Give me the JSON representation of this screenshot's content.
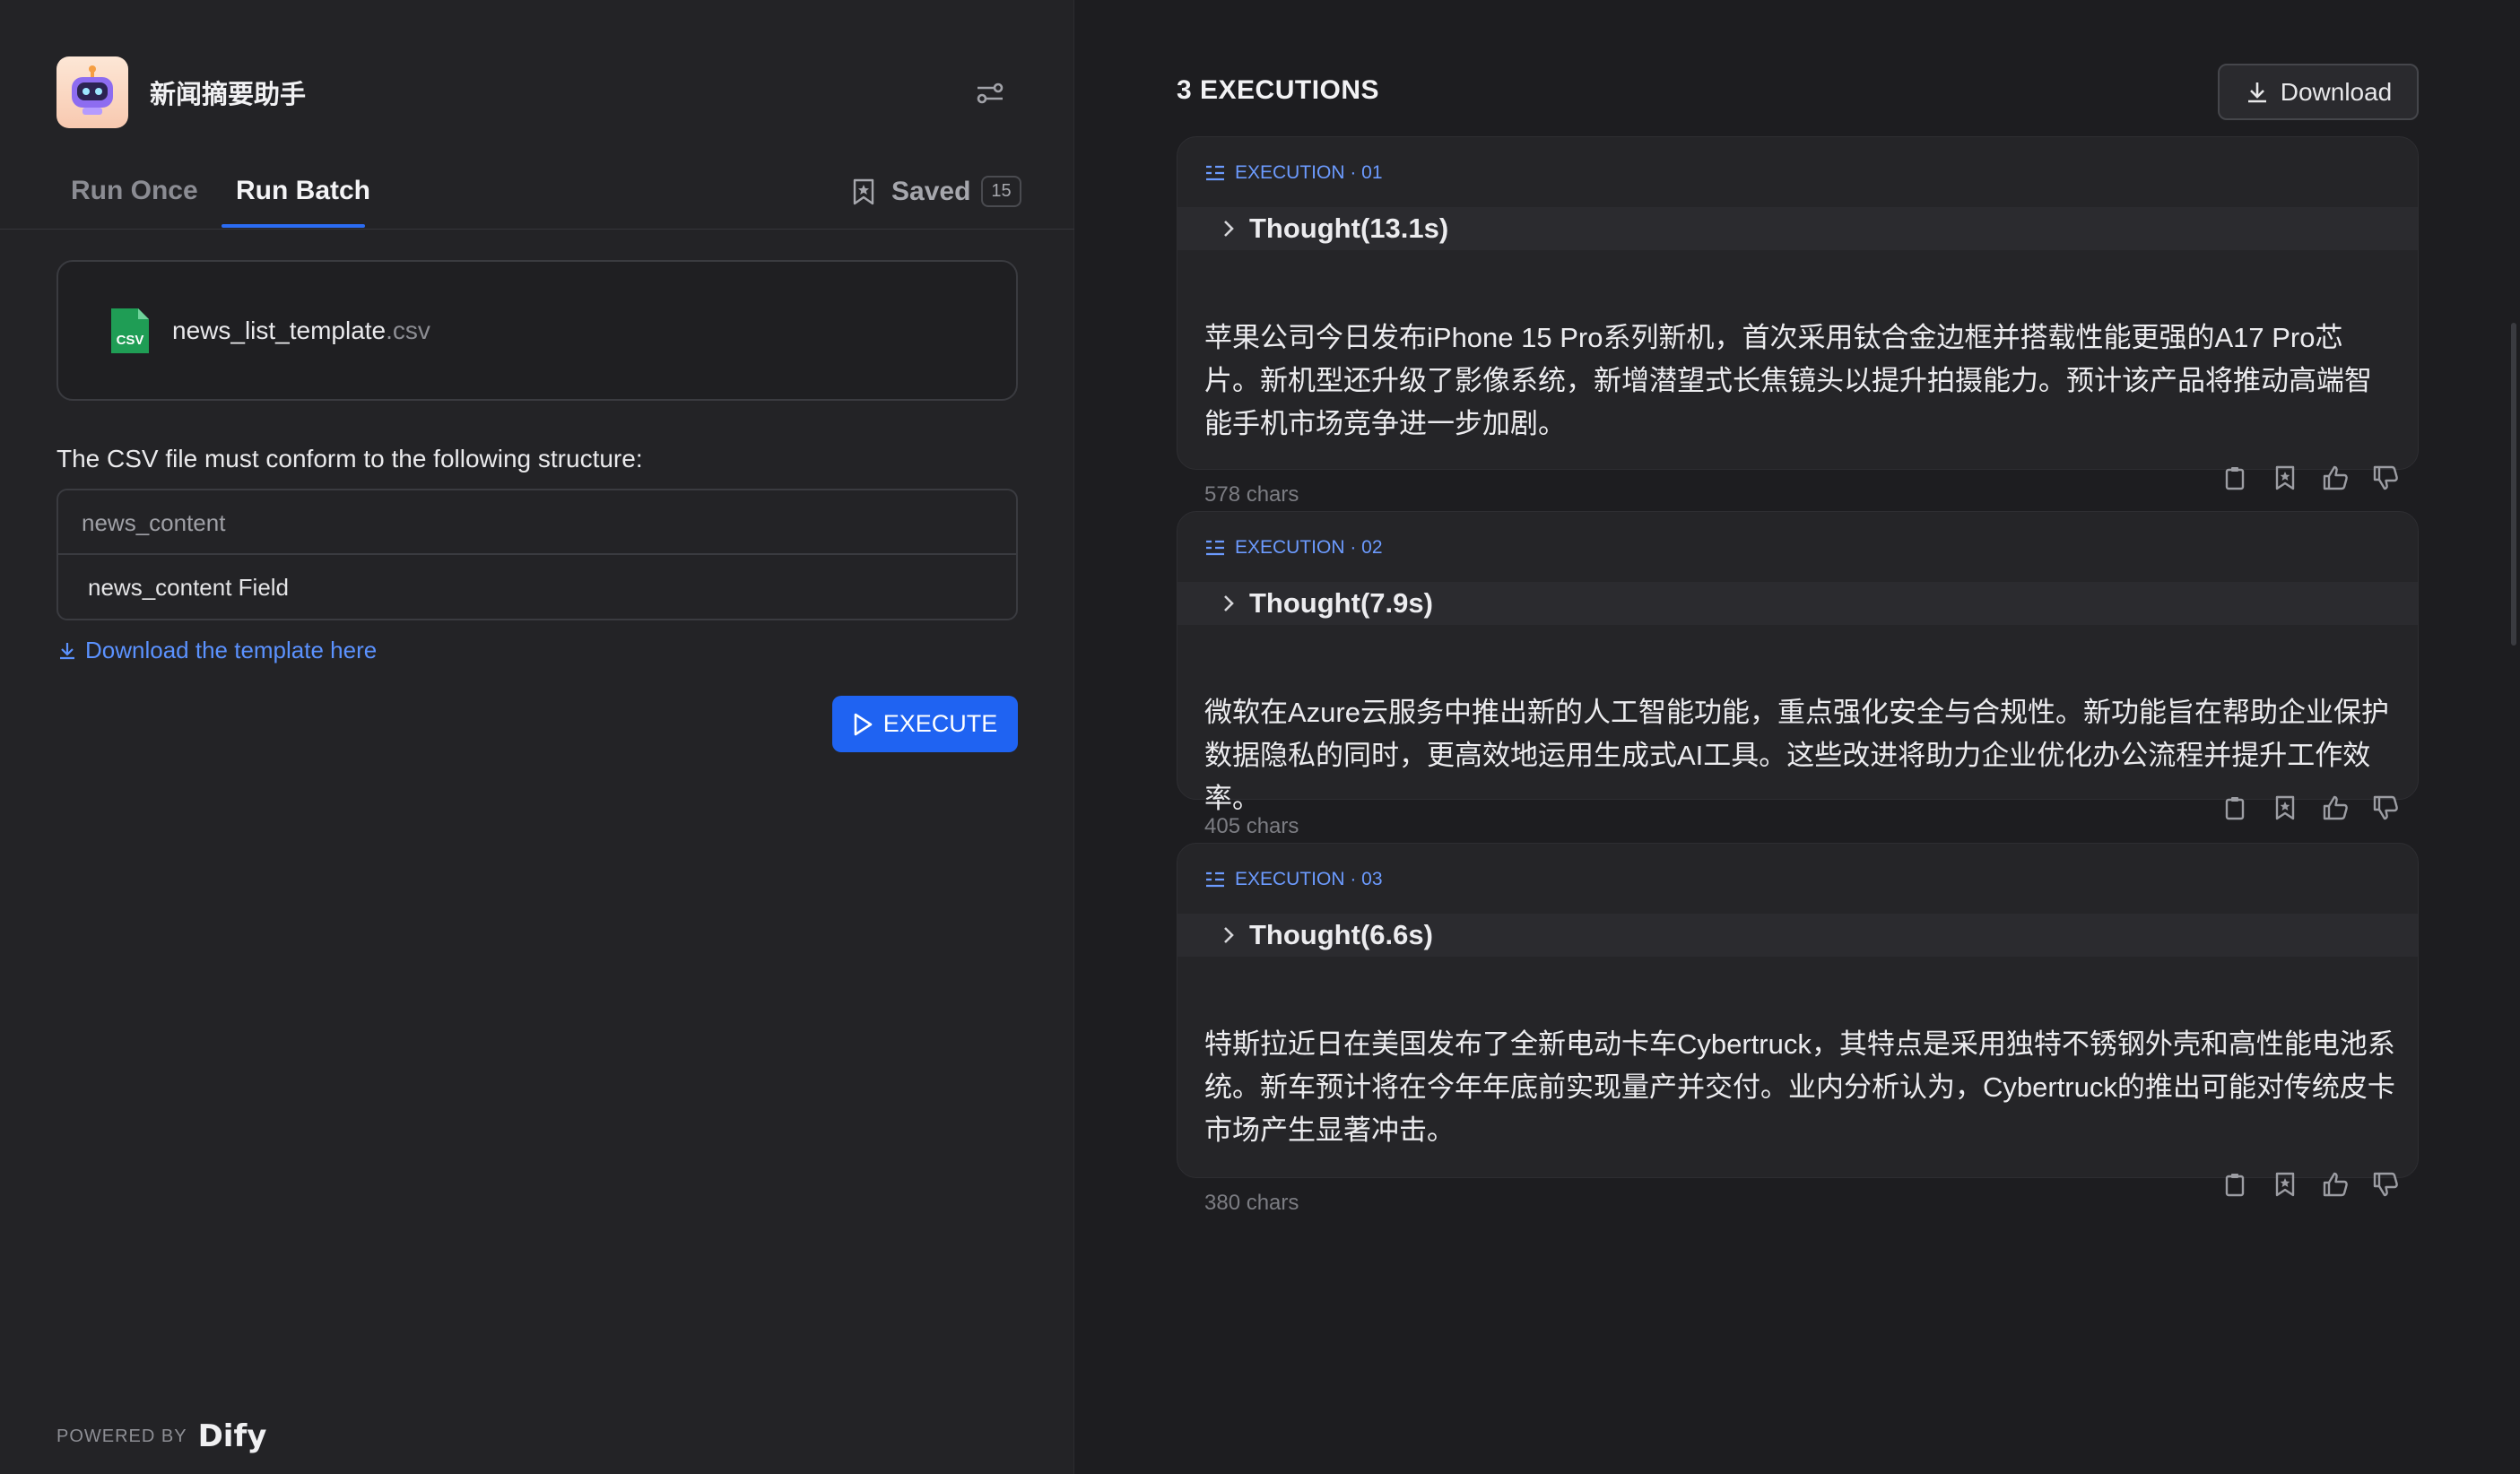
{
  "app": {
    "title": "新闻摘要助手"
  },
  "tabs": [
    {
      "label": "Run Once",
      "active": false
    },
    {
      "label": "Run Batch",
      "active": true
    }
  ],
  "saved": {
    "label": "Saved",
    "count": "15"
  },
  "upload": {
    "file_base": "news_list_template",
    "file_ext": ".csv",
    "file_icon_text": "CSV"
  },
  "structure": {
    "label": "The CSV file must conform to the following structure:",
    "header": "news_content",
    "row": "news_content Field"
  },
  "template_link": "Download the template here",
  "execute_label": "EXECUTE",
  "footer": {
    "powered_by": "POWERED BY",
    "brand": "Dify"
  },
  "results": {
    "title": "3 EXECUTIONS",
    "download_label": "Download",
    "executions": [
      {
        "tag": "EXECUTION · 01",
        "thought": "Thought(13.1s)",
        "text": "苹果公司今日发布iPhone 15 Pro系列新机，首次采用钛合金边框并搭载性能更强的A17 Pro芯片。新机型还升级了影像系统，新增潜望式长焦镜头以提升拍摄能力。预计该产品将推动高端智能手机市场竞争进一步加剧。",
        "chars": "578 chars"
      },
      {
        "tag": "EXECUTION · 02",
        "thought": "Thought(7.9s)",
        "text": "微软在Azure云服务中推出新的人工智能功能，重点强化安全与合规性。新功能旨在帮助企业保护数据隐私的同时，更高效地运用生成式AI工具。这些改进将助力企业优化办公流程并提升工作效率。",
        "chars": "405 chars"
      },
      {
        "tag": "EXECUTION · 03",
        "thought": "Thought(6.6s)",
        "text": "特斯拉近日在美国发布了全新电动卡车Cybertruck，其特点是采用独特不锈钢外壳和高性能电池系统。新车预计将在今年年底前实现量产并交付。业内分析认为，Cybertruck的推出可能对传统皮卡市场产生显著冲击。",
        "chars": "380 chars"
      }
    ]
  },
  "colors": {
    "accent": "#1f63f2",
    "link": "#5b92ff",
    "background": "#1d1d20",
    "panel": "#232326"
  }
}
